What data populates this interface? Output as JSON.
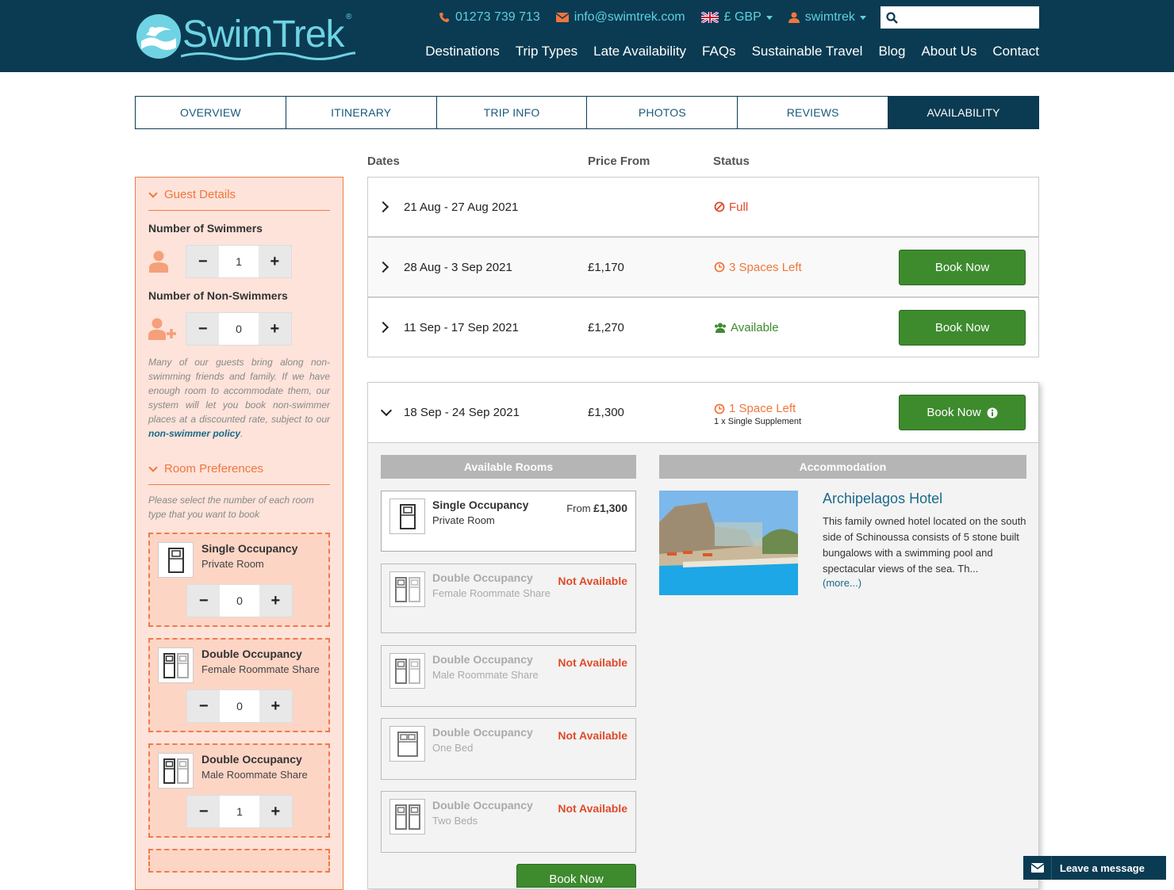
{
  "brand": {
    "name": "SwimTrek",
    "reg": "®"
  },
  "topbar": {
    "phone": "01273 739 713",
    "email": "info@swimtrek.com",
    "currency": "£ GBP",
    "account": "swimtrek",
    "search_placeholder": ""
  },
  "nav": [
    "Destinations",
    "Trip Types",
    "Late Availability",
    "FAQs",
    "Sustainable Travel",
    "Blog",
    "About Us",
    "Contact"
  ],
  "tabs": [
    "OVERVIEW",
    "ITINERARY",
    "TRIP INFO",
    "PHOTOS",
    "REVIEWS",
    "AVAILABILITY"
  ],
  "sidebar": {
    "guest_title": "Guest Details",
    "swimmers_label": "Number of Swimmers",
    "swimmers": "1",
    "nonswimmers_label": "Number of Non-Swimmers",
    "nonswimmers": "0",
    "note_pre": "Many of our guests bring along non-swimming friends and family. If we have enough room to accommodate them, our system will let you book non-swimmer places at a discounted rate, subject to our ",
    "note_link": "non-swimmer policy",
    "note_post": ".",
    "room_title": "Room Preferences",
    "room_note": "Please select the number of each room type that you want to book",
    "rooms": [
      {
        "t1": "Single Occupancy",
        "t2": "Private Room",
        "count": "0"
      },
      {
        "t1": "Double Occupancy",
        "t2": "Female Roommate Share",
        "count": "0"
      },
      {
        "t1": "Double Occupancy",
        "t2": "Male Roommate Share",
        "count": "1"
      }
    ]
  },
  "columns": {
    "dates": "Dates",
    "price": "Price From",
    "status": "Status"
  },
  "rows": [
    {
      "dates": "21 Aug - 27 Aug 2021",
      "price": "",
      "status": "Full"
    },
    {
      "dates": "28 Aug - 3 Sep 2021",
      "price": "£1,170",
      "status": "3 Spaces Left",
      "book": "Book Now"
    },
    {
      "dates": "11 Sep - 17 Sep 2021",
      "price": "£1,270",
      "status": "Available",
      "book": "Book Now"
    }
  ],
  "expanded": {
    "dates": "18 Sep - 24 Sep 2021",
    "price": "£1,300",
    "status": "1 Space Left",
    "status_sub": "1 x Single Supplement",
    "book": "Book Now",
    "rooms_title": "Available Rooms",
    "accom_title": "Accommodation",
    "rooms": [
      {
        "t1": "Single Occupancy",
        "t2": "Private Room",
        "from": "From",
        "price": "£1,300"
      },
      {
        "t1": "Double Occupancy",
        "t2": "Female Roommate Share",
        "na": "Not Available"
      },
      {
        "t1": "Double Occupancy",
        "t2": "Male Roommate Share",
        "na": "Not Available"
      },
      {
        "t1": "Double Occupancy",
        "t2": "One Bed",
        "na": "Not Available"
      },
      {
        "t1": "Double Occupancy",
        "t2": "Two Beds",
        "na": "Not Available"
      }
    ],
    "hotel": {
      "name": "Archipelagos Hotel",
      "desc": "This family owned hotel located on the south side of Schinoussa consists of 5 stone built bungalows with a swimming pool and spectacular views of the sea. Th...",
      "more": "(more...)"
    }
  },
  "chat": "Leave a message",
  "colors": {
    "navy": "#0a3b52",
    "accent": "#5fd0e2",
    "orange": "#f0763d",
    "green": "#3e8b2e",
    "red": "#e04a2a"
  }
}
